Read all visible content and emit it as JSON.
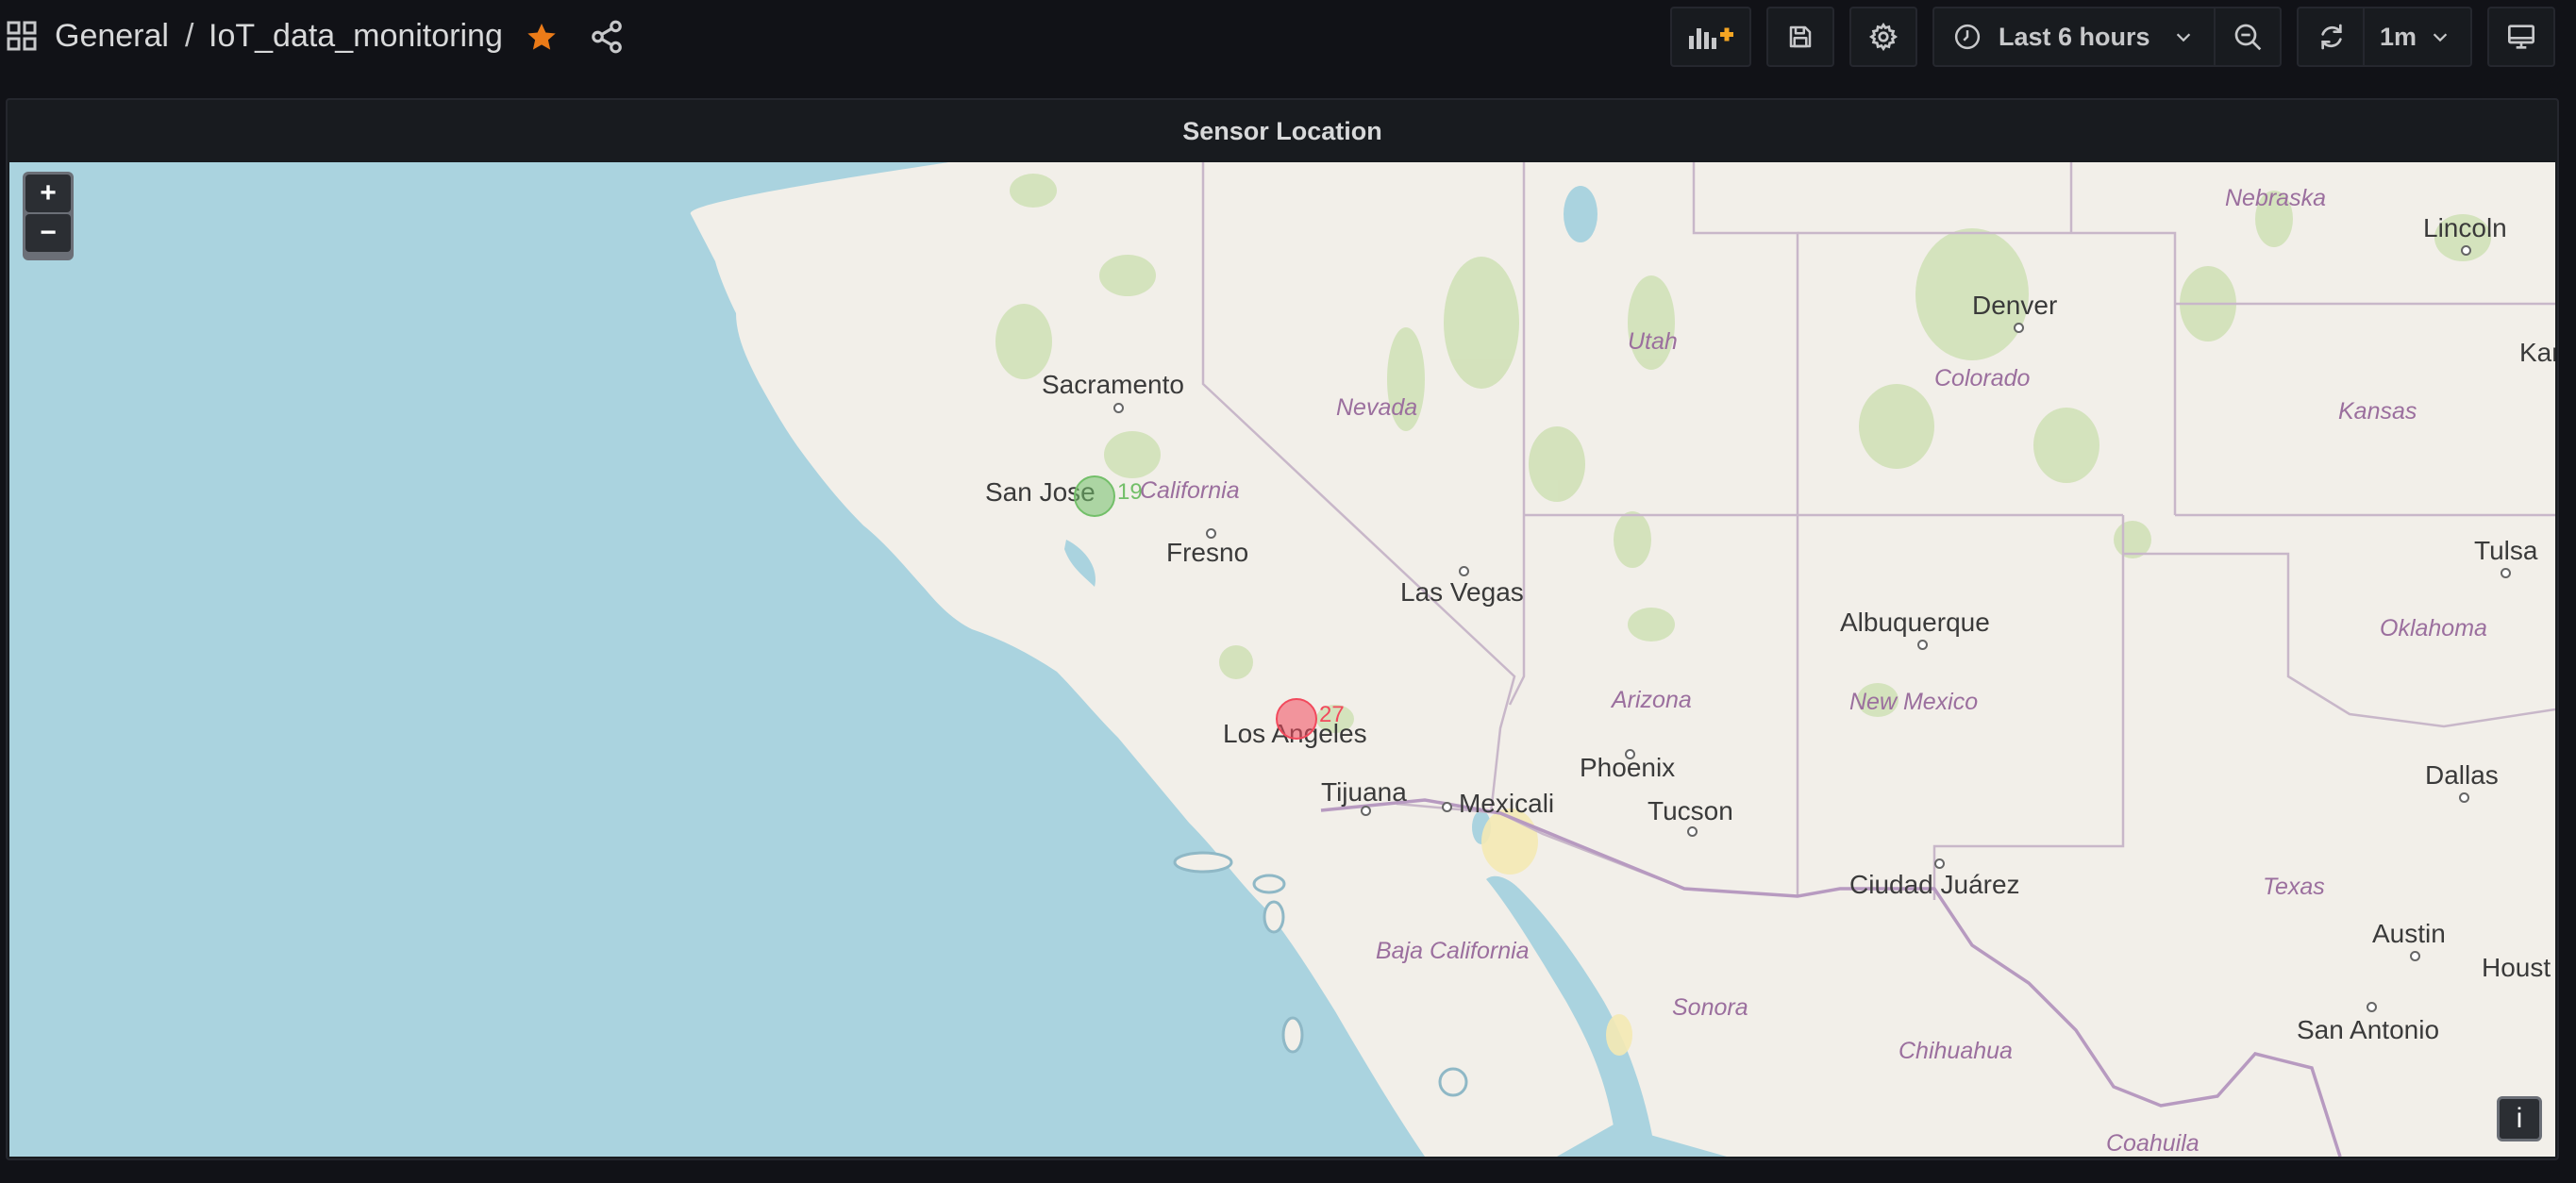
{
  "nav": {
    "apps_icon": "apps-grid-icon",
    "folder": "General",
    "separator": "/",
    "dashboard_title": "IoT_data_monitoring",
    "starred": true,
    "star_color": "#eb7b18",
    "share_icon": "share-icon"
  },
  "toolbar": {
    "add_panel_icon": "add-panel-icon",
    "save_icon": "save-icon",
    "settings_icon": "gear-icon",
    "time_range": "Last 6 hours",
    "zoom_out_icon": "zoom-out-icon",
    "refresh_icon": "refresh-icon",
    "refresh_interval": "1m",
    "tv_mode_icon": "monitor-icon"
  },
  "panel": {
    "title": "Sensor Location"
  },
  "map": {
    "zoom_in": "+",
    "zoom_out": "−",
    "info": "i",
    "markers": [
      {
        "name": "sensor-san-jose",
        "value": "19",
        "color": "#73bf69"
      },
      {
        "name": "sensor-los-angeles",
        "value": "27",
        "color": "#f2495c"
      }
    ],
    "cities": [
      "Sacramento",
      "San Jose",
      "Fresno",
      "Las Vegas",
      "Los Angeles",
      "Tijuana",
      "Mexicali",
      "Phoenix",
      "Tucson",
      "Albuquerque",
      "Ciudad Juárez",
      "Denver",
      "Lincoln",
      "Tulsa",
      "Dallas",
      "Austin",
      "San Antonio",
      "Houst",
      "Kan"
    ],
    "regions": [
      "Nebraska",
      "Utah",
      "Colorado",
      "Kansas",
      "Nevada",
      "California",
      "Oklahoma",
      "Arizona",
      "New Mexico",
      "Texas",
      "Baja California",
      "Sonora",
      "Chihuahua",
      "Coahuila"
    ]
  }
}
